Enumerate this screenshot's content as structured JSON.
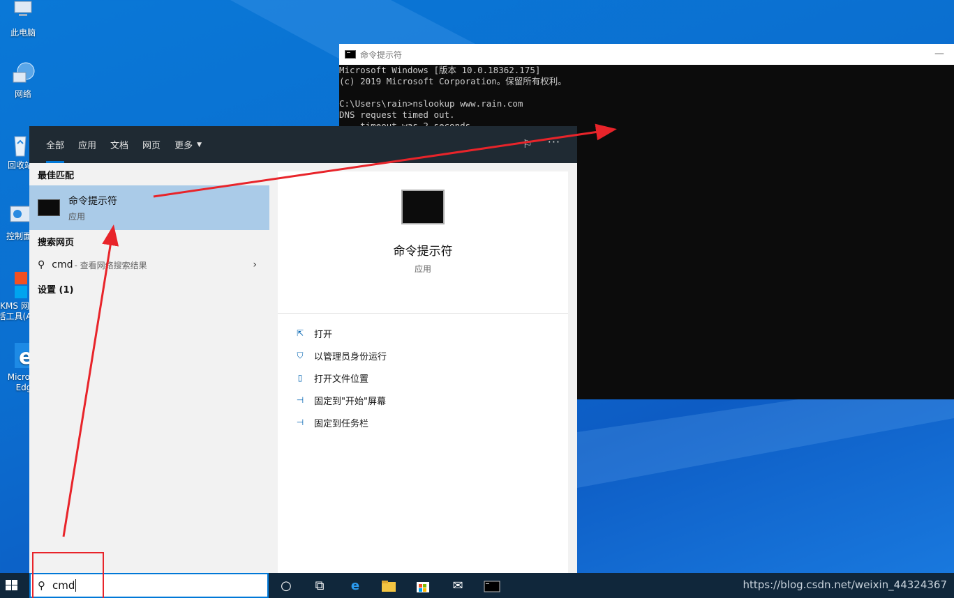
{
  "desktop": {
    "icons": [
      {
        "label": "此电脑"
      },
      {
        "label": "网络"
      },
      {
        "label": "回收站"
      },
      {
        "label": "控制面"
      },
      {
        "label": "KMS 网"
      },
      {
        "label": "活工具(A"
      },
      {
        "label": "Micros"
      },
      {
        "label": "Edg"
      }
    ]
  },
  "cmd": {
    "title": "命令提示符",
    "lines": [
      "Microsoft Windows [版本 10.0.18362.175]",
      "(c) 2019 Microsoft Corporation。保留所有权利。",
      "",
      "C:\\Users\\rain>nslookup www.rain.com",
      "DNS request timed out.",
      "    timeout was 2 seconds."
    ]
  },
  "search": {
    "tabs": [
      "全部",
      "应用",
      "文档",
      "网页",
      "更多"
    ],
    "best_match_title": "最佳匹配",
    "best_match": {
      "name": "命令提示符",
      "type": "应用"
    },
    "web_title": "搜索网页",
    "web_query": "cmd",
    "web_hint": " - 查看网络搜索结果",
    "settings_title": "设置 (1)",
    "preview": {
      "name": "命令提示符",
      "type": "应用"
    },
    "actions": [
      "打开",
      "以管理员身份运行",
      "打开文件位置",
      "固定到\"开始\"屏幕",
      "固定到任务栏"
    ]
  },
  "taskbar": {
    "search_value": "cmd",
    "watermark": "https://blog.csdn.net/weixin_44324367"
  },
  "colors": {
    "accent": "#0078d7",
    "annotation": "#e8242a",
    "highlight": "#aacbe8"
  }
}
